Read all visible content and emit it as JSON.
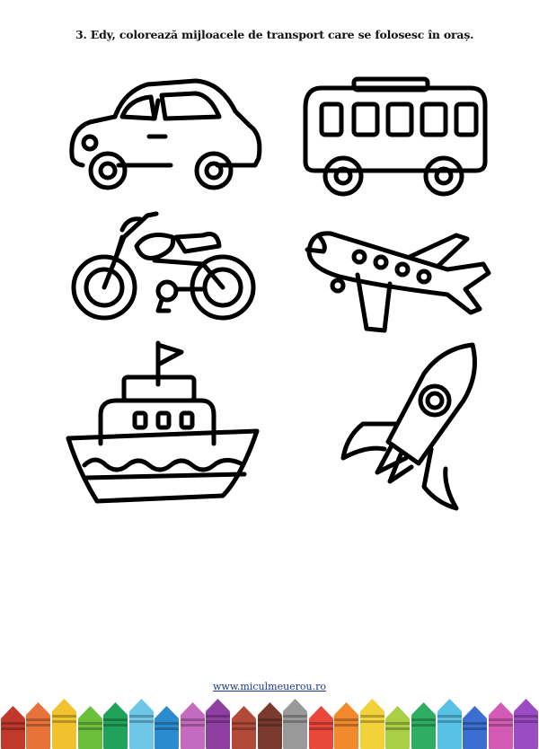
{
  "header": {
    "instruction": "3. Edy, colorează mijloacele de transport care se folosesc în oraș."
  },
  "drawings": [
    {
      "name": "car"
    },
    {
      "name": "bus"
    },
    {
      "name": "motorcycle"
    },
    {
      "name": "airplane"
    },
    {
      "name": "boat"
    },
    {
      "name": "rocket"
    }
  ],
  "footer": {
    "website": "www.miculmeuerou.ro",
    "crayon_colors": [
      "#c0392b",
      "#e8733a",
      "#f2c12e",
      "#6bbf3b",
      "#1fa35a",
      "#6fc7e8",
      "#2a8ccf",
      "#c46bbf",
      "#8e3fa0",
      "#b24a3a",
      "#7a3b2e",
      "#999999",
      "#e8473a",
      "#f08a2c",
      "#f3d13a",
      "#a9cf45",
      "#2fae63",
      "#58c2e6",
      "#3a6fd1",
      "#d35bb5",
      "#9b4cc2"
    ]
  }
}
